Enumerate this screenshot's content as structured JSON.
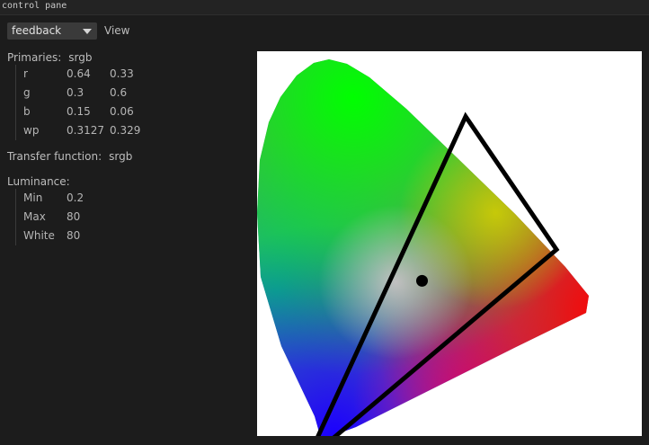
{
  "window": {
    "title": "control pane"
  },
  "toolbar": {
    "mode_select": {
      "selected": "feedback"
    },
    "view_label": "View"
  },
  "primaries": {
    "label": "Primaries:",
    "value": "srgb",
    "rows": [
      {
        "name": "r",
        "x": "0.64",
        "y": "0.33"
      },
      {
        "name": "g",
        "x": "0.3",
        "y": "0.6"
      },
      {
        "name": "b",
        "x": "0.15",
        "y": "0.06"
      },
      {
        "name": "wp",
        "x": "0.3127",
        "y": "0.329"
      }
    ]
  },
  "transfer": {
    "label": "Transfer function:",
    "value": "srgb"
  },
  "luminance": {
    "label": "Luminance:",
    "rows": [
      {
        "name": "Min",
        "value": "0.2"
      },
      {
        "name": "Max",
        "value": "80"
      },
      {
        "name": "White",
        "value": "80"
      }
    ]
  },
  "chart_data": {
    "type": "scatter",
    "gamut_triangle": [
      [
        0.64,
        0.33
      ],
      [
        0.3,
        0.6
      ],
      [
        0.15,
        0.06
      ]
    ],
    "white_point": [
      0.3127,
      0.329
    ]
  },
  "colors": {
    "background": "#1c1c1c",
    "plot_background": "#ffffff",
    "triangle_stroke": "#000000",
    "white_point": "#000000"
  }
}
